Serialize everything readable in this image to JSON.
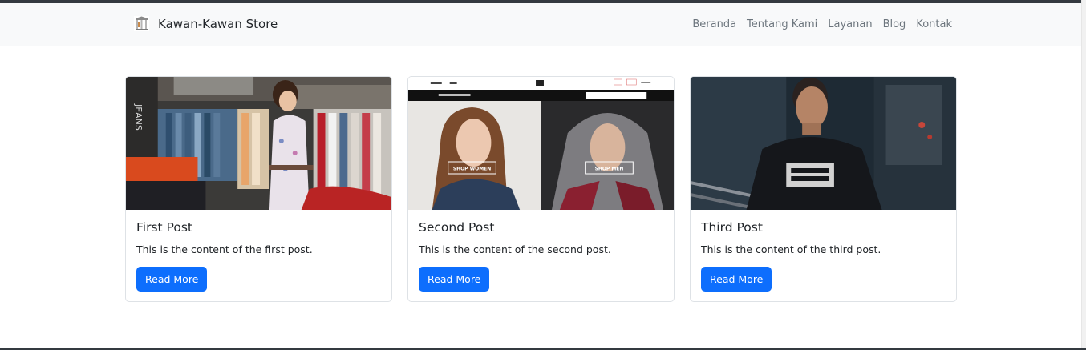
{
  "navbar": {
    "brand": "Kawan-Kawan Store",
    "links": [
      "Beranda",
      "Tentang Kami",
      "Layanan",
      "Blog",
      "Kontak"
    ]
  },
  "posts": [
    {
      "title": "First Post",
      "content": "This is the content of the first post.",
      "button": "Read More",
      "image_alt": "woman shopping in clothing store"
    },
    {
      "title": "Second Post",
      "content": "This is the content of the second post.",
      "button": "Read More",
      "image_alt": "fashion website banner with shop women and shop men"
    },
    {
      "title": "Third Post",
      "content": "This is the content of the third post.",
      "button": "Read More",
      "image_alt": "man in black graphic t-shirt"
    }
  ],
  "banner_text": {
    "shop_women": "SHOP WOMEN",
    "shop_men": "SHOP MEN"
  },
  "colors": {
    "navbar_bg": "#f8f9fa",
    "primary": "#0d6efd",
    "nav_text": "#6c757d"
  }
}
